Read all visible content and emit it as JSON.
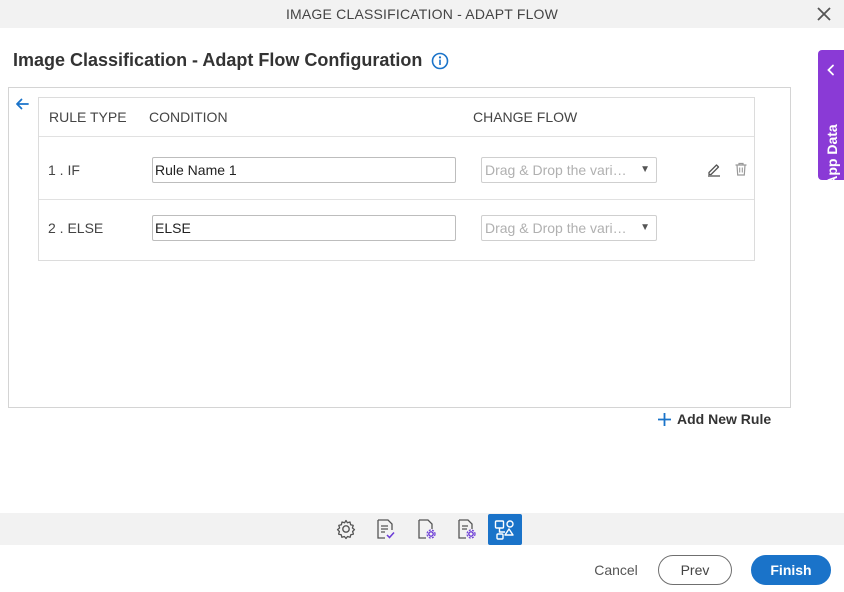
{
  "window": {
    "title": "IMAGE CLASSIFICATION - ADAPT FLOW",
    "close_icon": "close-icon"
  },
  "page": {
    "title": "Image Classification - Adapt Flow Configuration",
    "info_icon": "info-icon"
  },
  "table": {
    "headers": {
      "rule_type": "RULE TYPE",
      "condition": "CONDITION",
      "change_flow": "CHANGE FLOW"
    },
    "rows": [
      {
        "type": "1 . IF",
        "condition": "Rule Name 1",
        "change_flow_placeholder": "Drag & Drop the variable",
        "actions": [
          "edit-icon",
          "delete-icon"
        ]
      },
      {
        "type": "2 . ELSE",
        "condition": "ELSE",
        "change_flow_placeholder": "Drag & Drop the variable",
        "actions": []
      }
    ]
  },
  "add_rule": {
    "label": "Add New Rule"
  },
  "side_tab": {
    "label": "App Data"
  },
  "toolbar": {
    "icons": [
      "gear-icon",
      "form-check-icon",
      "doc-settings-icon",
      "doc-gear-icon",
      "flow-rules-icon"
    ],
    "active_index": 4
  },
  "footer": {
    "cancel": "Cancel",
    "prev": "Prev",
    "finish": "Finish"
  },
  "colors": {
    "primary": "#1a73c9",
    "side_tab": "#8a3ad6",
    "bar_bg": "#f2f2f2"
  }
}
